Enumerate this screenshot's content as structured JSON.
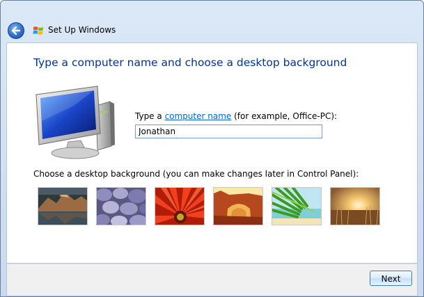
{
  "window": {
    "title": "Set Up Windows"
  },
  "icons": {
    "back": "back-arrow-icon",
    "windows_logo": "windows-flag-icon",
    "computer": "computer-monitor-icon"
  },
  "page": {
    "heading": "Type a computer name and choose a desktop background"
  },
  "computer_name": {
    "label_prefix": "Type a",
    "link_text": "computer name",
    "label_suffix": "(for example, Office-PC):",
    "value": "Jonathan"
  },
  "background": {
    "label": "Choose a desktop background (you can make changes later in Control Panel):",
    "thumbnails": [
      {
        "name": "mountain-lake"
      },
      {
        "name": "pebbles"
      },
      {
        "name": "red-flower"
      },
      {
        "name": "rock-arch"
      },
      {
        "name": "green-leaf"
      },
      {
        "name": "sunset-field"
      }
    ]
  },
  "footer": {
    "next_label": "Next"
  },
  "colors": {
    "heading": "#003399",
    "link": "#0066cc",
    "accent": "#3c7fb1"
  }
}
